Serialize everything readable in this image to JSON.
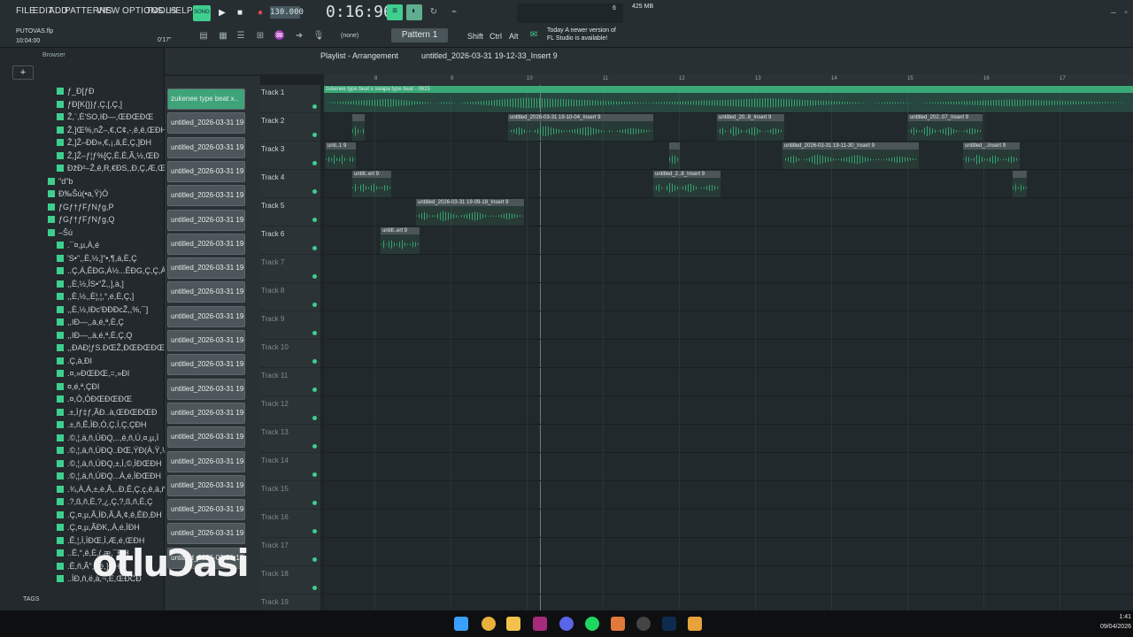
{
  "menu": [
    "FILE",
    "EDIT",
    "ADD",
    "PATTERNS",
    "VIEW",
    "OPTIONS",
    "TOOLS",
    "HELP"
  ],
  "tempo": "130.000",
  "time": "0:16:96",
  "project_file": "PUTOVAS.flp",
  "project_time": "10:04:00",
  "hint_time": "0'17\"",
  "memory": "425 MB",
  "cpu": "6",
  "snap": "(none)",
  "pattern": "Pattern 1",
  "keys": {
    "shift": "Shift",
    "ctrl": "Ctrl",
    "alt": "Alt"
  },
  "news": {
    "line1": "Today  A newer version of",
    "line2": "FL Studio is available!"
  },
  "playlist_title": "Playlist - Arrangement",
  "breadcrumb": "untitled_2026-03-31 19-12-33_Insert 9",
  "browser_label": "Browser",
  "tags_label": "TAGS",
  "browser_items": [
    "ƒ_Ð[ƒÐ",
    "ƒÐ[K{}}ƒ,Ç,[,Ç,]",
    "Ž,¨,È'SO,IÐ—,ŒÐŒÐŒ",
    "Ž,]Œ%,nŽ–,€,C¢,-,ê,ê,ŒÐH",
    "Ž,]Ž–ÐÐ»,€,¡,ã,È,Ç,]ÐH",
    "Ž,]Ž–ƒ¦ƒ%[Ç,È,È,Ã,½,ŒÐ",
    "ÐžÐ²–Ž,ê,R,€ÐS,,Ð,Ç,Æ,Œ",
    "\"d\"b",
    "Ð‰Šú(•a,Ÿ)Ó",
    "ƒGƒ†ƒFƒNƒg,P",
    "ƒGƒ†ƒFƒNƒg,Q",
    "–Šú",
    ".¯¤,µ,À,é",
    "'S•\",,È,½,]\"•,¶,á,È,Ç",
    "..Ç,Á,ÊÐG,Á½...ÊÐG,Ç,Ç,Á",
    ",,È,½,ÏS•\"Ž,,],à,]",
    ",,È,½,,È¦,¦,°,é,È,Ç,]",
    ",,È,½,IÐc'ÐÐÐcŽ,,%,¯]",
    ",,IÐ—,,à,é,ª,È,Ç",
    ",,IÐ—,,à,é,ª,È,Ç,Q",
    ",,ÐAÐ¦ƒS.ÐŒŽ,ÐŒÐŒÐŒ",
    ".Ç,à,ÐI",
    ".¤,»ÐŒÐŒ,=,»ÐI",
    "¤,é,ª,ÇÐI",
    ".¤,Ò,ÓÐŒÐŒÐŒ",
    ".±,Ìƒ‡ƒ,ÃÐ..à,ŒÐŒÐŒÐ",
    ".±,ñ,Ê,ÌÐ,Ó,Ç,Í,Ç,ÇÐH",
    ".©,¦,ä,ñ,ÚÐQ,..,ê,ñ,Ú,¤,µ,Ì",
    ".©,¦,ä,ñ,ÚÐQ..ÐŒ,ÝÐ(À,Ÿ,½",
    ".©,¦,ä,ñ,ÚÐQ,±,Ì,©,ÌÐŒÐH",
    ".©,¦,ä,ñ,ÚÐQ...À,é,ÌÐŒÐH",
    ".¾,À,Á,±,è,Ã,..Ð,Ê,Ç,ç,ê,ä,ñ",
    ".?,ß,ñ,È,?,¿,Ç,?,ß,ñ,È,Ç",
    ".Ç,¤,µ,Ã,ÌÐ,Ã,Å,¢,ê,ÊÐ,ÐH",
    ".Ç,¤,µ,ÃÐK,,À,é,ÌÐH",
    ".Ê,¦,Ì,ÌÐŒ,Ì,Æ,é,ŒÐH",
    "..Ë,°,ê,È,(,æ,¯ÐH",
    ".Ê,ñ,Ã\",°,é,]ÐH",
    "..ÌÐ,ñ,ë,à,¬,Ë,ŒÐCÐ"
  ],
  "picker_items": [
    "zukenee type beat x..",
    "untitled_2026-03-31 19-..",
    "untitled_2026-03-31 19-..",
    "untitled_2026-03-31 19-..",
    "untitled_2026-03-31 19-..",
    "untitled_2026-03-31 19-..",
    "untitled_2026-03-31 19-..",
    "untitled_2026-03-31 19-..",
    "untitled_2026-03-31 19-..",
    "untitled_2026-03-31 19-..",
    "untitled_2026-03-31 19-..",
    "untitled_2026-03-31 19-..",
    "untitled_2026-03-31 19-..",
    "untitled_2026-03-31 19-..",
    "untitled_2026-03-31 19-..",
    "untitled_2026-03-31 19-..",
    "untitled_2026-03-31 19-..",
    "untitled_2026-03-31 19-..",
    "untitled_2026-03-31 19-..",
    "untitled_2026-03-31 19-.."
  ],
  "tracks": [
    "Track 1",
    "Track 2",
    "Track 3",
    "Track 4",
    "Track 5",
    "Track 6",
    "Track 7",
    "Track 8",
    "Track 9",
    "Track 10",
    "Track 11",
    "Track 12",
    "Track 13",
    "Track 14",
    "Track 15",
    "Track 16",
    "Track 17",
    "Track 18",
    "Track 19"
  ],
  "ruler": [
    "8",
    "9",
    "10",
    "11",
    "12",
    "13",
    "14",
    "15",
    "16",
    "17"
  ],
  "clips": [
    {
      "track": 0,
      "label": "zukenee type beat x swapa type beat - 0615",
      "start": 0,
      "len": 914
    },
    {
      "track": 1,
      "label": "",
      "start": 32,
      "len": 14
    },
    {
      "track": 1,
      "label": "untitled_2026-03-31 19-10-04_Insert 9",
      "start": 208,
      "len": 164
    },
    {
      "track": 1,
      "label": "untitled_20..8_Insert 9",
      "start": 444,
      "len": 76
    },
    {
      "track": 1,
      "label": "untitled_202..07_Insert 9",
      "start": 660,
      "len": 84
    },
    {
      "track": 2,
      "label": "unti..1 9",
      "start": 2,
      "len": 34
    },
    {
      "track": 2,
      "label": "",
      "start": 390,
      "len": 12
    },
    {
      "track": 2,
      "label": "untitled_2026-03-31 19-11-30_Insert 9",
      "start": 518,
      "len": 154
    },
    {
      "track": 2,
      "label": "untitled_..Insert 9",
      "start": 722,
      "len": 64
    },
    {
      "track": 3,
      "label": "untitl..ert 9",
      "start": 32,
      "len": 44
    },
    {
      "track": 3,
      "label": "untitled_2..8_Insert 9",
      "start": 372,
      "len": 76
    },
    {
      "track": 3,
      "label": "",
      "start": 778,
      "len": 16
    },
    {
      "track": 4,
      "label": "untitled_2026-03-31 19-09-18_Insert 9",
      "start": 104,
      "len": 122
    },
    {
      "track": 5,
      "label": "untitl..ert 9",
      "start": 64,
      "len": 44
    }
  ],
  "watermark": "otluƆasi",
  "clock": {
    "time": "1:41",
    "date": "09/04/2026"
  }
}
